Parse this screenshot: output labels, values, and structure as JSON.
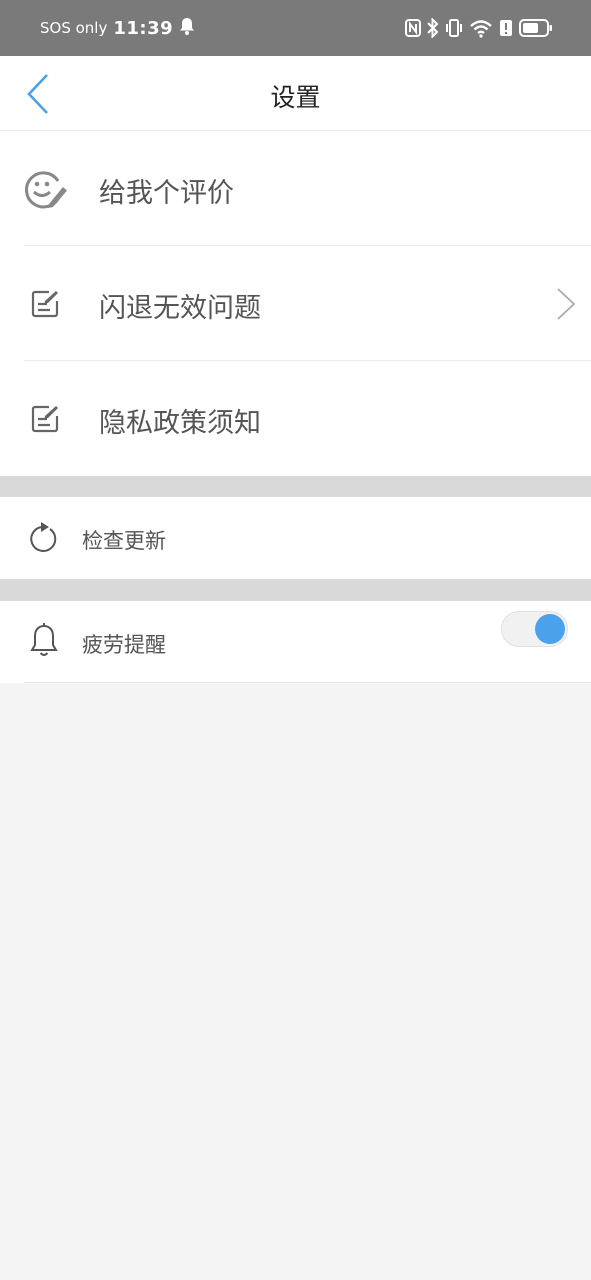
{
  "status_bar": {
    "carrier": "SOS only",
    "time": "11:39",
    "icons": [
      "bell-icon",
      "nfc-icon",
      "bluetooth-icon",
      "vibrate-icon",
      "wifi-icon",
      "alert-icon",
      "battery-icon"
    ]
  },
  "header": {
    "title": "设置",
    "back_icon": "chevron-left-icon"
  },
  "menu": {
    "rate": {
      "label": "给我个评价",
      "icon": "smiley-edit-icon"
    },
    "crash": {
      "label": "闪退无效问题",
      "icon": "note-edit-icon",
      "arrow_icon": "chevron-right-icon"
    },
    "privacy": {
      "label": "隐私政策须知",
      "icon": "note-edit-icon"
    }
  },
  "settings": {
    "update": {
      "label": "检查更新",
      "icon": "refresh-icon"
    },
    "fatigue": {
      "label": "疲劳提醒",
      "icon": "bell-outline-icon",
      "toggle_on": true
    }
  },
  "colors": {
    "accent": "#4aa3ea",
    "status_bar": "#7a7a7a",
    "page_bg": "#f4f4f4",
    "separator": "#d9d9d9"
  }
}
